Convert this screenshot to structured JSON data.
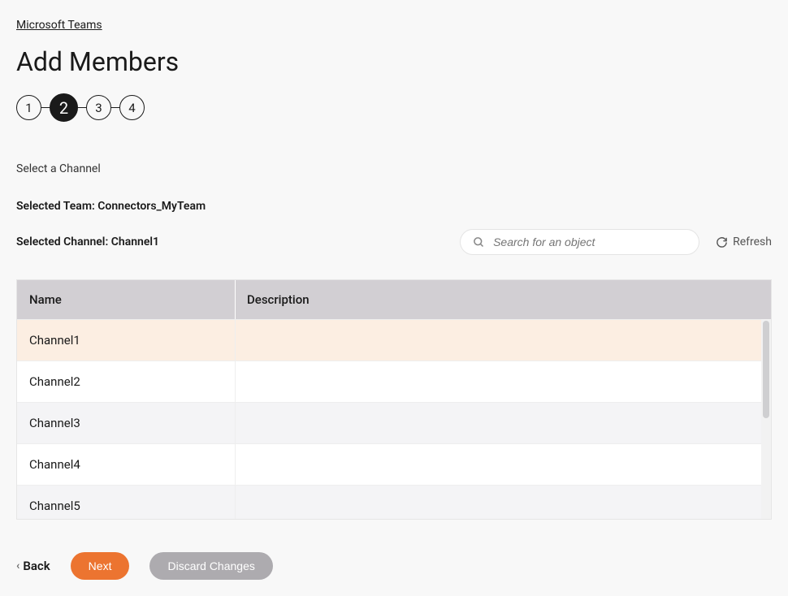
{
  "breadcrumb": "Microsoft Teams",
  "title": "Add Members",
  "steps": [
    "1",
    "2",
    "3",
    "4"
  ],
  "activeStep": 1,
  "subheading": "Select a Channel",
  "selectedTeam": "Selected Team: Connectors_MyTeam",
  "selectedChannel": "Selected Channel: Channel1",
  "search": {
    "placeholder": "Search for an object"
  },
  "refreshLabel": "Refresh",
  "columns": {
    "name": "Name",
    "description": "Description"
  },
  "rows": [
    {
      "name": "Channel1",
      "description": "",
      "selected": true
    },
    {
      "name": "Channel2",
      "description": "",
      "selected": false
    },
    {
      "name": "Channel3",
      "description": "",
      "selected": false
    },
    {
      "name": "Channel4",
      "description": "",
      "selected": false
    },
    {
      "name": "Channel5",
      "description": "",
      "selected": false
    }
  ],
  "footer": {
    "back": "Back",
    "next": "Next",
    "discard": "Discard Changes"
  }
}
